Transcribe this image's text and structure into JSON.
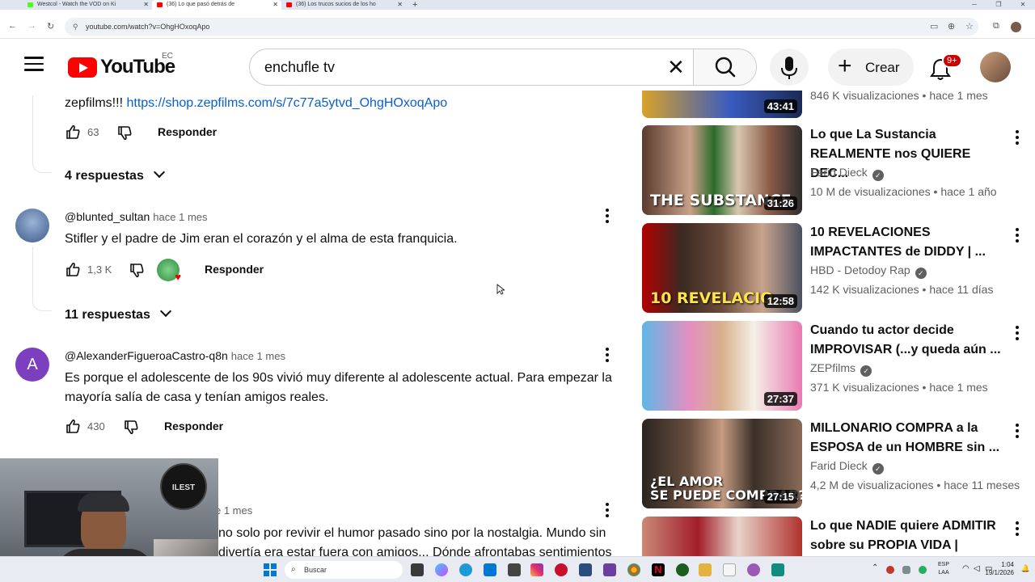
{
  "browser": {
    "tabs": [
      {
        "title": "Westcol - Watch the VOD on Ki",
        "color": "#53fc18"
      },
      {
        "title": "(36) Lo que pasó detrás de",
        "color": "#ff0000"
      },
      {
        "title": "(36) Los trucos sucios de los ho",
        "color": "#ff0000"
      }
    ],
    "url": "youtube.com/watch?v=OhgHOxoqApo"
  },
  "header": {
    "logo_text": "YouTube",
    "country_code": "EC",
    "search_value": "enchufle tv",
    "create_label": "Crear",
    "notifications_badge": "9+"
  },
  "comments": {
    "partial_top": {
      "text_prefix": "zepfilms!!! ",
      "link": "https://shop.zepfilms.com/s/7c77a5ytvd_OhgHOxoqApo",
      "likes": "63",
      "reply_label": "Responder",
      "replies_label": "4 respuestas"
    },
    "items": [
      {
        "handle": "@blunted_sultan",
        "time": "hace 1 mes",
        "text": "Stifler y el padre de Jim eran el corazón y el alma de esta franquicia.",
        "likes": "1,3 K",
        "reply_label": "Responder",
        "replies_label": "11 respuestas"
      },
      {
        "handle": "@AlexanderFigueroaCastro-q8n",
        "time": "hace 1 mes",
        "avatar_letter": "A",
        "text": "Es porque el adolescente de los 90s vivió muy diferente al adolescente actual. Para empezar la mayoría salía de casa y tenían amigos reales.",
        "likes": "430",
        "reply_label": "Responder"
      },
      {
        "time_partial": "e 1 mes",
        "text_line1": "no solo por revivir el humor pasado sino por la nostalgia. Mundo sin",
        "text_line2": "divertía era estar fuera con amigos... Dónde afrontabas sentimientos"
      }
    ]
  },
  "sidebar": {
    "partial_top": {
      "meta": "846 K visualizaciones • hace 1 mes",
      "duration": "43:41"
    },
    "videos": [
      {
        "title": "Lo que La Sustancia REALMENTE nos QUIERE DEC...",
        "channel": "Farid Dieck",
        "meta": "10 M de visualizaciones • hace 1 año",
        "duration": "31:26",
        "thumb_text": "THE SUBSTANCE"
      },
      {
        "title": "10 REVELACIONES IMPACTANTES de DIDDY | ...",
        "channel": "HBD - Detodoy Rap",
        "meta": "142 K visualizaciones • hace 11 días",
        "duration": "12:58",
        "thumb_text": "10 REVELACIO"
      },
      {
        "title": "Cuando tu actor decide IMPROVISAR (...y queda aún ...",
        "channel": "ZEPfilms",
        "meta": "371 K visualizaciones • hace 1 mes",
        "duration": "27:37",
        "thumb_text": ""
      },
      {
        "title": "MILLONARIO COMPRA a la ESPOSA de un HOMBRE sin ...",
        "channel": "Farid Dieck",
        "meta": "4,2 M de visualizaciones • hace 11 meses",
        "duration": "27:15",
        "thumb_text": "¿EL AMOR\nSE PUEDE COMPRAR?"
      },
      {
        "title": "Lo que NADIE quiere ADMITIR sobre su PROPIA VIDA | Bellez...",
        "channel": "",
        "meta": "",
        "duration": "",
        "thumb_text": ""
      }
    ]
  },
  "taskbar": {
    "search_label": "Buscar",
    "lang_line1": "ESP",
    "lang_line2": "LAA",
    "time": "1:04",
    "date": "19/1/2026"
  },
  "webcam": {
    "sign_text": "ILEST"
  }
}
